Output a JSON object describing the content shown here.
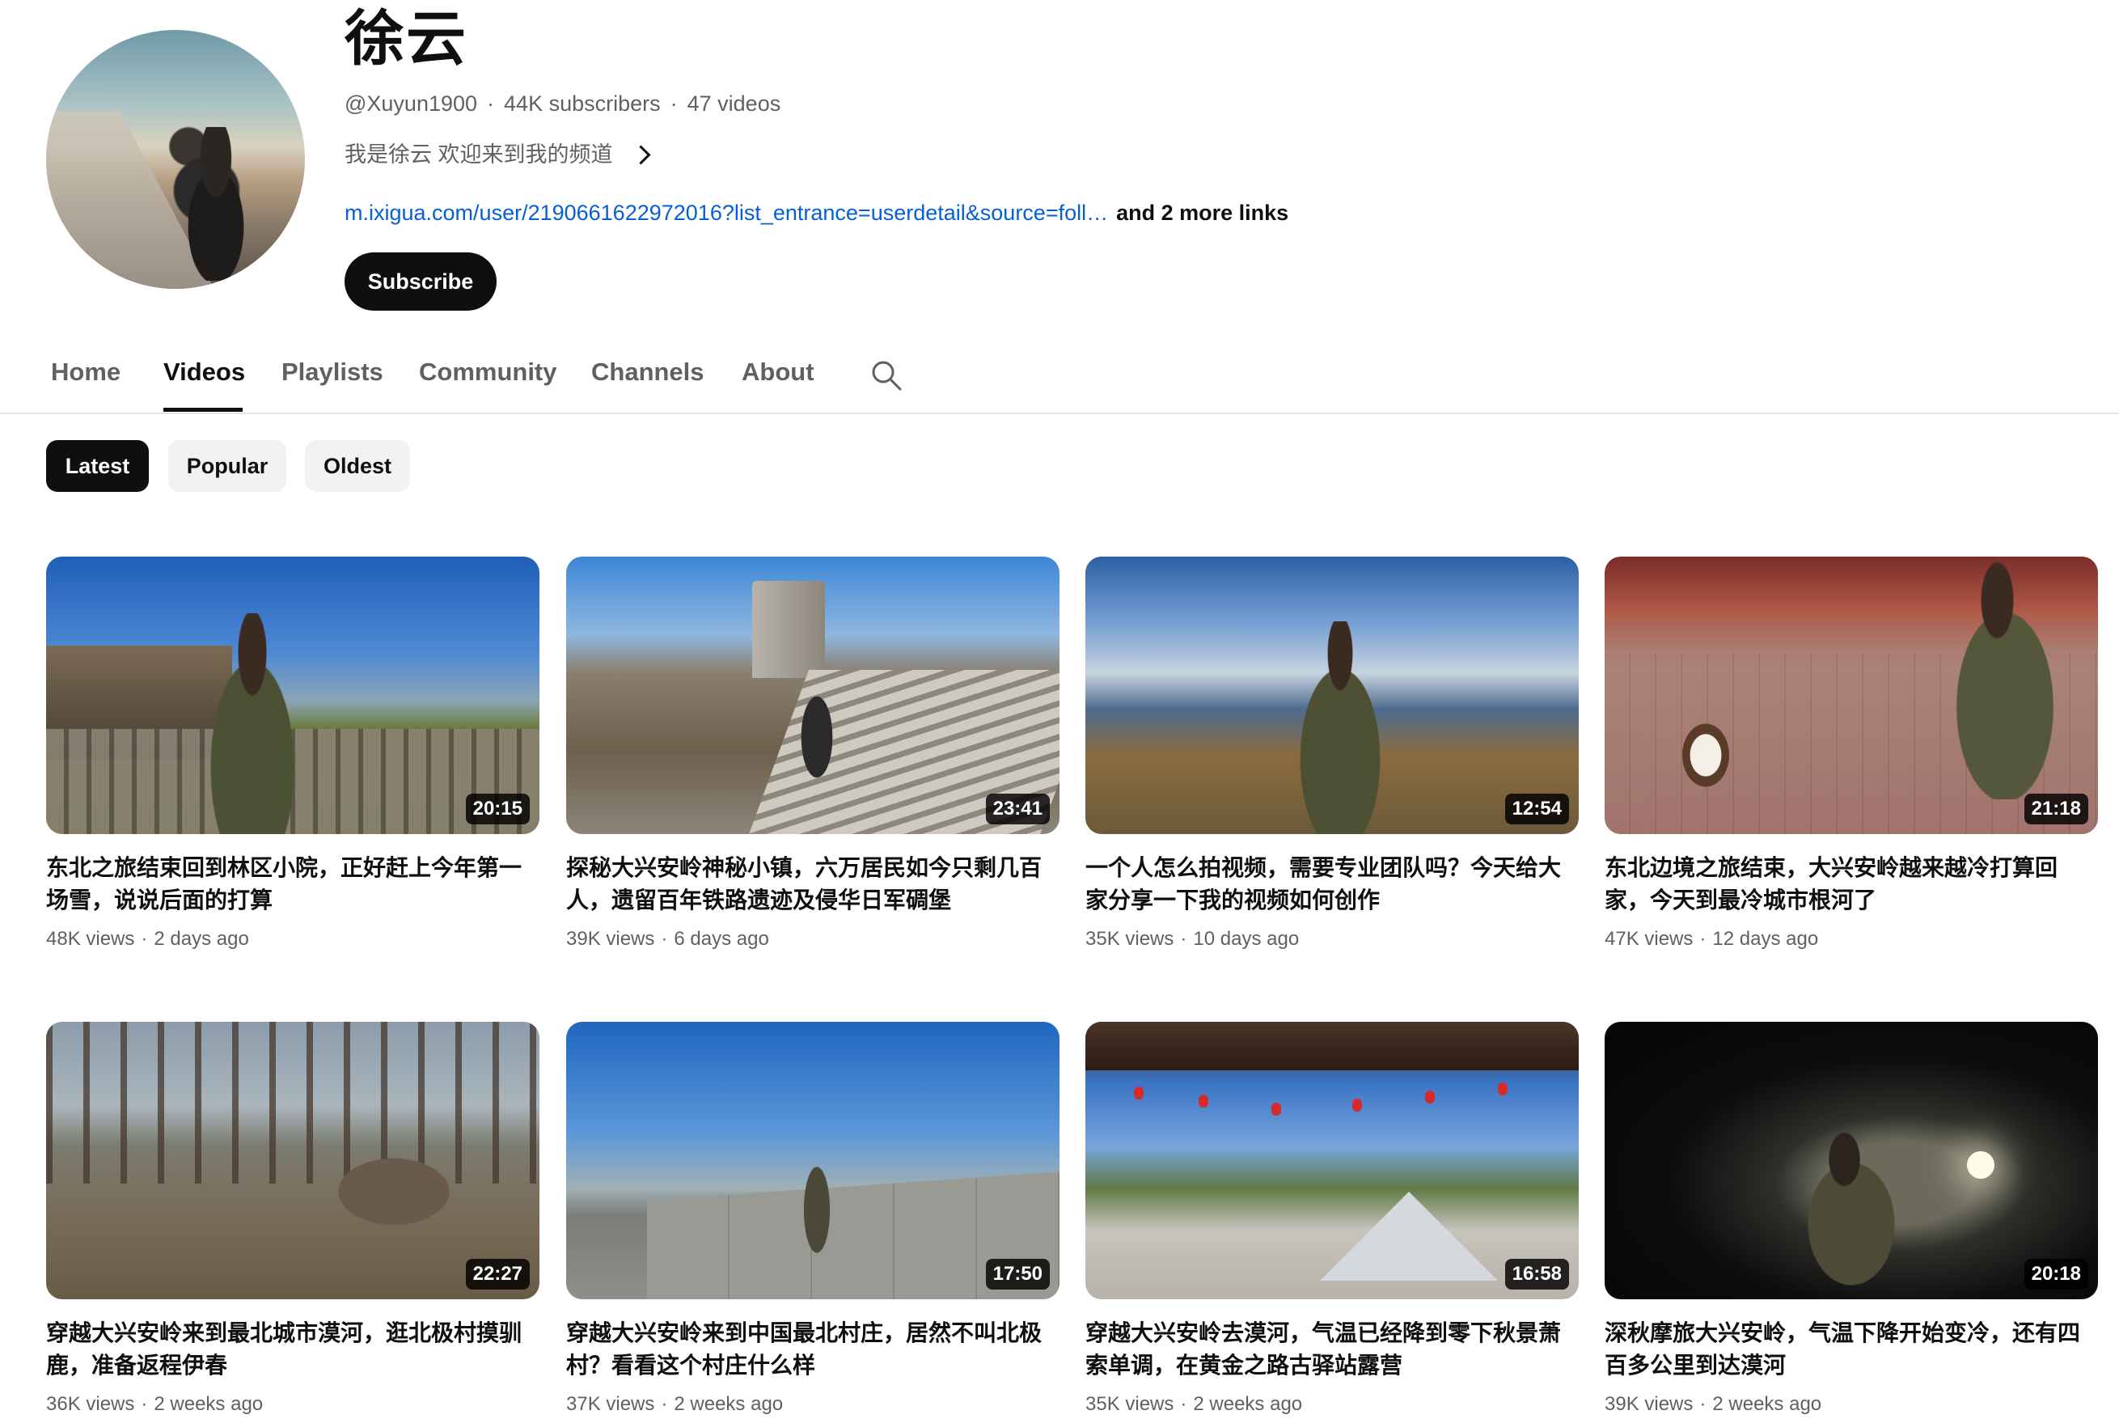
{
  "channel": {
    "name": "徐云",
    "handle": "@Xuyun1900",
    "subscribers": "44K subscribers",
    "videos_count": "47 videos",
    "separator": "·",
    "description": "我是徐云 欢迎来到我的频道",
    "link": "m.ixigua.com/user/2190661622972016?list_entrance=userdetail&source=foll…",
    "more_links": "and 2 more links",
    "subscribe_label": "Subscribe"
  },
  "tabs": [
    {
      "label": "Home",
      "active": false
    },
    {
      "label": "Videos",
      "active": true
    },
    {
      "label": "Playlists",
      "active": false
    },
    {
      "label": "Community",
      "active": false
    },
    {
      "label": "Channels",
      "active": false
    },
    {
      "label": "About",
      "active": false
    }
  ],
  "filters": [
    {
      "label": "Latest",
      "active": true
    },
    {
      "label": "Popular",
      "active": false
    },
    {
      "label": "Oldest",
      "active": false
    }
  ],
  "videos": [
    {
      "title": "东北之旅结束回到林区小院，正好赶上今年第一场雪，说说后面的打算",
      "duration": "20:15",
      "views": "48K views",
      "age": "2 days ago"
    },
    {
      "title": "探秘大兴安岭神秘小镇，六万居民如今只剩几百人，遗留百年铁路遗迹及侵华日军碉堡",
      "duration": "23:41",
      "views": "39K views",
      "age": "6 days ago"
    },
    {
      "title": "一个人怎么拍视频，需要专业团队吗？今天给大家分享一下我的视频如何创作",
      "duration": "12:54",
      "views": "35K views",
      "age": "10 days ago"
    },
    {
      "title": "东北边境之旅结束，大兴安岭越来越冷打算回家，今天到最冷城市根河了",
      "duration": "21:18",
      "views": "47K views",
      "age": "12 days ago"
    },
    {
      "title": "穿越大兴安岭来到最北城市漠河，逛北极村摸驯鹿，准备返程伊春",
      "duration": "22:27",
      "views": "36K views",
      "age": "2 weeks ago"
    },
    {
      "title": "穿越大兴安岭来到中国最北村庄，居然不叫北极村？看看这个村庄什么样",
      "duration": "17:50",
      "views": "37K views",
      "age": "2 weeks ago"
    },
    {
      "title": "穿越大兴安岭去漠河，气温已经降到零下秋景萧索单调，在黄金之路古驿站露营",
      "duration": "16:58",
      "views": "35K views",
      "age": "2 weeks ago"
    },
    {
      "title": "深秋摩旅大兴安岭，气温下降开始变冷，还有四百多公里到达漠河",
      "duration": "20:18",
      "views": "39K views",
      "age": "2 weeks ago"
    }
  ],
  "icons": {
    "search": "search-icon",
    "chevron": "chevron-right-icon"
  },
  "colors": {
    "link": "#065fd4",
    "subscribe_bg": "#0f0f0f",
    "chip_active": "#0f0f0f",
    "chip_inactive": "#f2f2f2",
    "secondary_text": "#606060"
  }
}
